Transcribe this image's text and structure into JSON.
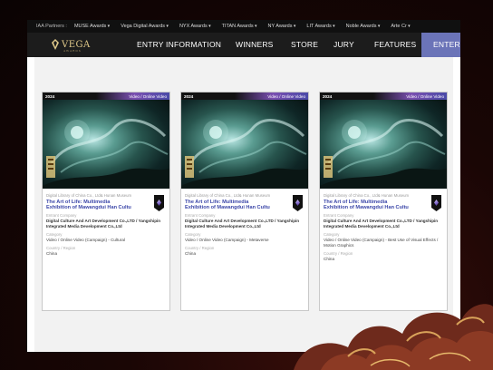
{
  "partners": {
    "label": "IAA Partners :",
    "items": [
      "MUSE Awards",
      "Vega Digital Awards",
      "NYX Awards",
      "TITAN Awards",
      "NY Awards",
      "LIT Awards",
      "Noble Awards",
      "Arte Cr"
    ]
  },
  "logo": {
    "name": "VEGA",
    "sub": "AWARDS"
  },
  "nav": {
    "items": [
      "ENTRY INFORMATION",
      "WINNERS",
      "STORE",
      "JURY",
      "FEATURES"
    ],
    "enter": "ENTER"
  },
  "cards": [
    {
      "year": "2024",
      "category": "Video / Online Video",
      "org": "Digital Library of China Co., Ltd& Hunan Museum",
      "title": "The Art of Life: Multimedia Exhibition of Mawangdui Han Cultu",
      "entrant_label": "Entrant Company",
      "entrant": "Digital Culture And Art Development Co.,LTD / Yangshipin Integrated Media Development Co.,Ltd",
      "category_label": "Category",
      "category_value": "Video / Online Video (Campaign) - Cultural",
      "country_label": "Country / Region",
      "country": "China"
    },
    {
      "year": "2024",
      "category": "Video / Online Video",
      "org": "Digital Library of China Co., Ltd& Hunan Museum",
      "title": "The Art of Life: Multimedia Exhibition of Mawangdui Han Cultu",
      "entrant_label": "Entrant Company",
      "entrant": "Digital Culture And Art Development Co.,LTD / Yangshipin Integrated Media Development Co.,Ltd",
      "category_label": "Category",
      "category_value": "Video / Online Video (Campaign) - Metaverse",
      "country_label": "Country / Region",
      "country": "China"
    },
    {
      "year": "2024",
      "category": "Video / Online Video",
      "org": "Digital Library of China Co., Ltd& Hunan Museum",
      "title": "The Art of Life: Multimedia Exhibition of Mawangdui Han Cultu",
      "entrant_label": "Entrant Company",
      "entrant": "Digital Culture And Art Development Co.,LTD / Yangshipin Integrated Media Development Co.,Ltd",
      "category_label": "Category",
      "category_value": "Video / Online Video (Campaign) - Best Use of Visual Effects / Motion Graphics",
      "country_label": "Country / Region",
      "country": "China"
    }
  ],
  "colors": {
    "accent": "#6b74b8",
    "title": "#3b46a8",
    "nav_bg": "#1c1c1c",
    "gold": "#e0c98a"
  }
}
